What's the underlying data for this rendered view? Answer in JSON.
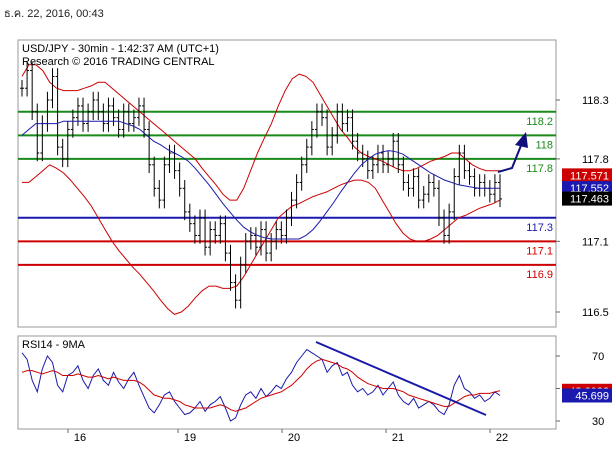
{
  "timestamp": "ธ.ค. 22, 2016, 00:43",
  "header": {
    "line1": "USD/JPY - 30min - 1:42:37 AM (UTC+1)",
    "line2": "Research © 2016 TRADING CENTRAL"
  },
  "colors": {
    "candle": "#000000",
    "bollinger": "#cc0000",
    "ma": "#1a1aaa",
    "green_level": "#1a8a1a",
    "red_level": "#cc0000",
    "blue_level": "#1a1ab0",
    "arrow": "#10107a",
    "rsi": "#1a1aaa",
    "rsi_ma": "#cc0000",
    "trendline": "#1a1aaa"
  },
  "chart_data": [
    {
      "type": "candlestick",
      "title": "USD/JPY - 30min - 1:42:37 AM (UTC+1)",
      "subtitle": "Research © 2016 TRADING CENTRAL",
      "x_ticks": [
        "16",
        "19",
        "20",
        "21",
        "22"
      ],
      "y_ticks": [
        118.3,
        117.8,
        117.1,
        116.5
      ],
      "ylim": [
        116.4,
        118.65
      ],
      "levels": [
        {
          "label": "118.2",
          "value": 118.2,
          "color": "green"
        },
        {
          "label": "118",
          "value": 118.0,
          "color": "green"
        },
        {
          "label": "117.8",
          "value": 117.8,
          "color": "green"
        },
        {
          "label": "117.3",
          "value": 117.3,
          "color": "blue"
        },
        {
          "label": "117.1",
          "value": 117.1,
          "color": "red"
        },
        {
          "label": "116.9",
          "value": 116.9,
          "color": "red"
        }
      ],
      "price_tags": [
        {
          "label": "117.571",
          "value": 117.66,
          "color": "red"
        },
        {
          "label": "117.552",
          "value": 117.552,
          "color": "blue"
        },
        {
          "label": "117.463",
          "value": 117.463,
          "color": "black"
        }
      ],
      "close": [
        118.4,
        118.55,
        118.2,
        117.85,
        118.1,
        118.3,
        118.5,
        117.9,
        117.8,
        118.05,
        118.15,
        118.25,
        118.1,
        118.2,
        118.3,
        118.2,
        118.1,
        118.25,
        118.15,
        118.05,
        118.2,
        118.1,
        118.15,
        118.25,
        118.05,
        117.75,
        117.55,
        117.45,
        117.75,
        117.85,
        117.7,
        117.55,
        117.35,
        117.25,
        117.15,
        117.3,
        117.05,
        117.2,
        117.15,
        117.25,
        117.0,
        116.75,
        116.6,
        116.9,
        117.1,
        117.15,
        117.05,
        117.2,
        117.0,
        117.1,
        117.2,
        117.15,
        117.3,
        117.45,
        117.6,
        117.75,
        117.9,
        118.05,
        118.2,
        118.15,
        117.9,
        118.0,
        118.2,
        118.1,
        118.15,
        117.95,
        117.85,
        117.8,
        117.7,
        117.75,
        117.85,
        117.75,
        117.8,
        117.95,
        117.75,
        117.6,
        117.55,
        117.65,
        117.45,
        117.5,
        117.6,
        117.55,
        117.3,
        117.15,
        117.35,
        117.65,
        117.85,
        117.7,
        117.65,
        117.55,
        117.6,
        117.55,
        117.5,
        117.6,
        117.46
      ],
      "ma": [
        118.0,
        118.05,
        118.1,
        118.1,
        118.1,
        118.1,
        118.12,
        118.12,
        118.12,
        118.12,
        118.12,
        118.12,
        118.12,
        118.12,
        118.12,
        118.1,
        118.08,
        118.05,
        118.0,
        117.95,
        117.92,
        117.88,
        117.85,
        117.82,
        117.78,
        117.72,
        117.65,
        117.58,
        117.5,
        117.42,
        117.35,
        117.28,
        117.22,
        117.18,
        117.15,
        117.13,
        117.12,
        117.12,
        117.12,
        117.12,
        117.12,
        117.15,
        117.2,
        117.27,
        117.35,
        117.43,
        117.52,
        117.6,
        117.68,
        117.75,
        117.8,
        117.84,
        117.86,
        117.87,
        117.86,
        117.84,
        117.8,
        117.76,
        117.72,
        117.68,
        117.65,
        117.62,
        117.6,
        117.58,
        117.57,
        117.56,
        117.55,
        117.55,
        117.55,
        117.55
      ],
      "bb_upper": [
        118.5,
        118.6,
        118.6,
        118.55,
        118.45,
        118.4,
        118.38,
        118.38,
        118.38,
        118.4,
        118.42,
        118.45,
        118.45,
        118.4,
        118.35,
        118.3,
        118.25,
        118.2,
        118.15,
        118.1,
        118.05,
        118.0,
        117.95,
        117.9,
        117.85,
        117.8,
        117.72,
        117.65,
        117.58,
        117.5,
        117.45,
        117.45,
        117.55,
        117.7,
        117.85,
        117.98,
        118.1,
        118.25,
        118.38,
        118.48,
        118.52,
        118.5,
        118.45,
        118.35,
        118.25,
        118.15,
        118.05,
        117.98,
        117.9,
        117.85,
        117.82,
        117.8,
        117.78,
        117.75,
        117.72,
        117.7,
        117.7,
        117.72,
        117.75,
        117.78,
        117.8,
        117.82,
        117.85,
        117.85,
        117.8,
        117.75,
        117.72,
        117.7,
        117.7,
        117.7
      ],
      "bb_lower": [
        117.6,
        117.6,
        117.65,
        117.7,
        117.75,
        117.72,
        117.68,
        117.62,
        117.55,
        117.48,
        117.4,
        117.3,
        117.2,
        117.1,
        117.02,
        116.95,
        116.88,
        116.82,
        116.75,
        116.68,
        116.6,
        116.53,
        116.48,
        116.5,
        116.55,
        116.62,
        116.68,
        116.72,
        116.72,
        116.7,
        116.7,
        116.72,
        116.8,
        116.9,
        117.0,
        117.1,
        117.2,
        117.3,
        117.35,
        117.4,
        117.42,
        117.45,
        117.48,
        117.5,
        117.52,
        117.55,
        117.58,
        117.6,
        117.62,
        117.62,
        117.6,
        117.55,
        117.45,
        117.35,
        117.25,
        117.17,
        117.12,
        117.1,
        117.1,
        117.12,
        117.15,
        117.2,
        117.25,
        117.3,
        117.32,
        117.35,
        117.38,
        117.4,
        117.42,
        117.45
      ]
    },
    {
      "type": "line",
      "title": "RSI14 - 9MA",
      "y_ticks": [
        70,
        50,
        30
      ],
      "ylim": [
        25,
        80
      ],
      "price_tags": [
        {
          "label": "48.6022",
          "value": 48.6,
          "color": "red"
        },
        {
          "label": "45.699",
          "value": 45.7,
          "color": "blue"
        }
      ],
      "series": [
        {
          "name": "RSI14",
          "values": [
            72,
            68,
            55,
            48,
            62,
            70,
            66,
            52,
            48,
            58,
            60,
            64,
            55,
            50,
            58,
            62,
            55,
            52,
            60,
            54,
            50,
            56,
            60,
            52,
            45,
            38,
            35,
            40,
            46,
            48,
            42,
            38,
            34,
            35,
            38,
            42,
            36,
            40,
            42,
            45,
            38,
            30,
            32,
            40,
            46,
            48,
            44,
            50,
            45,
            48,
            52,
            50,
            56,
            60,
            66,
            70,
            74,
            72,
            70,
            68,
            60,
            64,
            66,
            58,
            60,
            52,
            48,
            50,
            46,
            48,
            52,
            46,
            50,
            54,
            46,
            42,
            40,
            44,
            38,
            40,
            42,
            40,
            36,
            34,
            40,
            52,
            58,
            50,
            48,
            44,
            46,
            42,
            44,
            48,
            45.7
          ]
        },
        {
          "name": "9MA",
          "values": [
            60,
            61,
            61,
            60,
            59,
            60,
            61,
            60,
            58,
            58,
            58,
            59,
            58,
            57,
            57,
            58,
            57,
            56,
            57,
            56,
            55,
            55,
            55,
            54,
            52,
            49,
            46,
            45,
            44,
            44,
            43,
            42,
            40,
            39,
            38,
            38,
            38,
            38,
            39,
            40,
            39,
            37,
            36,
            37,
            38,
            40,
            42,
            44,
            45,
            46,
            47,
            48,
            50,
            52,
            55,
            58,
            62,
            65,
            67,
            68,
            67,
            66,
            65,
            63,
            62,
            60,
            57,
            55,
            53,
            52,
            51,
            50,
            50,
            50,
            49,
            48,
            46,
            45,
            44,
            43,
            42,
            41,
            40,
            39,
            39,
            41,
            43,
            45,
            46,
            46,
            47,
            47,
            47,
            48,
            48.6
          ]
        }
      ]
    }
  ]
}
